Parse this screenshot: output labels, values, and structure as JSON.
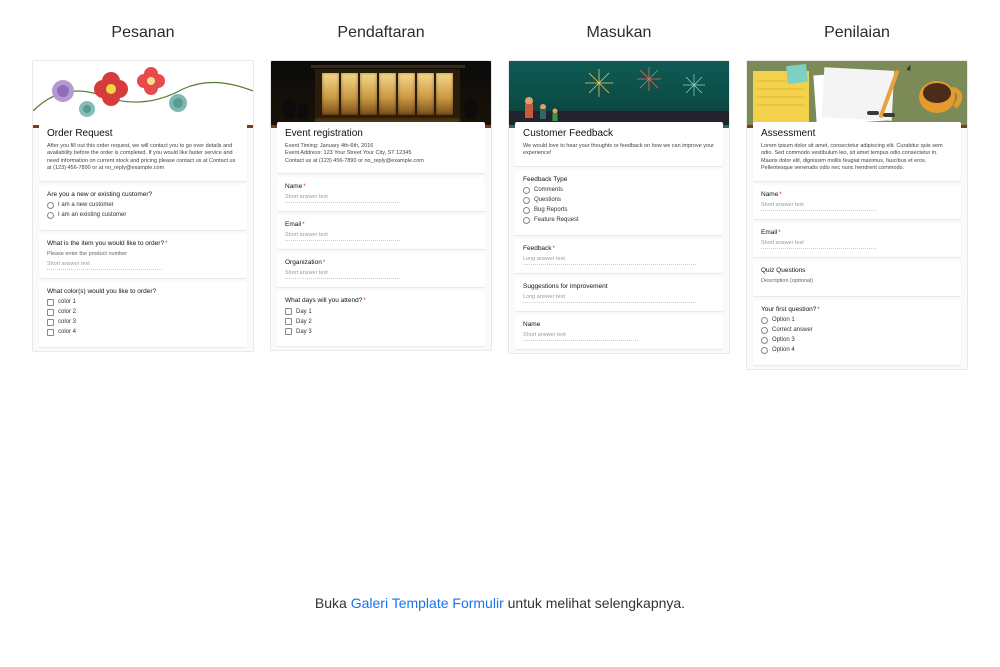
{
  "columns": [
    {
      "title": "Pesanan"
    },
    {
      "title": "Pendaftaran"
    },
    {
      "title": "Masukan"
    },
    {
      "title": "Penilaian"
    }
  ],
  "order": {
    "title": "Order Request",
    "desc": "After you fill out this order request, we will contact you to go over details and availability before the order is completed. If you would like faster service and need information on current stock and pricing please contact us at Contact us at (123) 456-7890 or at no_reply@example.com",
    "q1": "Are you a new or existing customer?",
    "q1_opt1": "I am a new customer",
    "q1_opt2": "I am an existing customer",
    "q2": "What is the item you would like to order?",
    "q2_hint": "Please enter the product number",
    "q2_ph": "Short answer text",
    "q3": "What color(s) would you like to order?",
    "q3_opt1": "color 1",
    "q3_opt2": "color 2",
    "q3_opt3": "color 3",
    "q3_opt4": "color 4"
  },
  "event": {
    "title": "Event registration",
    "desc_line1": "Event Timing: January 4th-6th, 2016",
    "desc_line2": "Event Address: 123 Your Street Your City, ST 12345",
    "desc_line3": "Contact us at (123) 456-7890 or no_reply@example.com",
    "q_name": "Name",
    "ph_short": "Short answer text",
    "q_email": "Email",
    "q_org": "Organization",
    "q_days": "What days will you attend?",
    "day1": "Day 1",
    "day2": "Day 2",
    "day3": "Day 3"
  },
  "feedback": {
    "title": "Customer Feedback",
    "desc": "We would love to hear your thoughts or feedback on how we can improve your experience!",
    "q_type": "Feedback Type",
    "opt_comments": "Comments",
    "opt_questions": "Questions",
    "opt_bugs": "Bug Reports",
    "opt_feature": "Feature Request",
    "q_feedback": "Feedback",
    "ph_long": "Long answer text",
    "q_sugg": "Suggestions for improvement",
    "q_name": "Name",
    "ph_short": "Short answer text"
  },
  "assess": {
    "title": "Assessment",
    "desc": "Lorem ipsum dolor sit amet, consectetur adipiscing elit. Curabitur quis sem odio. Sed commodo vestibulum leo, sit amet tempus odio consectetur in. Mauris dolor elit, dignissim mollis feugiat maximus, faucibus et eros. Pellentesque venenatis odio nec nunc hendrerit commodo.",
    "q_name": "Name",
    "ph_short": "Short answer text",
    "q_email": "Email",
    "q_quiz_hdr": "Quiz Questions",
    "quiz_sub": "Description (optional)",
    "q_first": "Your first question?",
    "opt1": "Option 1",
    "opt_correct": "Correct answer",
    "opt3": "Option 3",
    "opt4": "Option 4"
  },
  "footer": {
    "prefix": "Buka ",
    "link": "Galeri Template Formulir",
    "suffix": " untuk melihat selengkapnya."
  }
}
